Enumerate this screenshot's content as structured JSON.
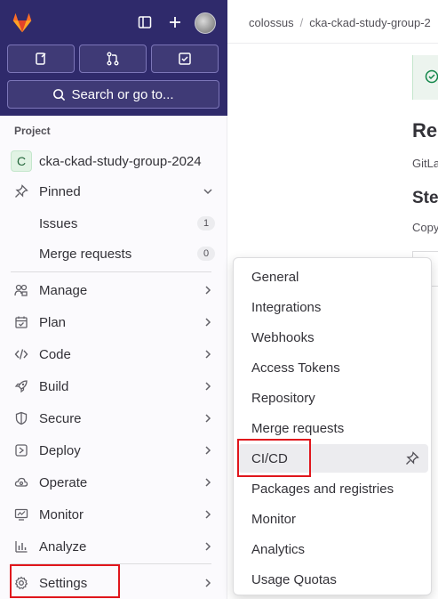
{
  "sidebar": {
    "search_label": "Search or go to...",
    "section_label": "Project",
    "project": {
      "initial": "C",
      "name": "cka-ckad-study-group-2024"
    },
    "pinned": {
      "label": "Pinned",
      "items": [
        {
          "label": "Issues",
          "count": "1"
        },
        {
          "label": "Merge requests",
          "count": "0"
        }
      ]
    },
    "nav": [
      {
        "label": "Manage",
        "icon": "manage-icon"
      },
      {
        "label": "Plan",
        "icon": "plan-icon"
      },
      {
        "label": "Code",
        "icon": "code-icon"
      },
      {
        "label": "Build",
        "icon": "rocket-icon"
      },
      {
        "label": "Secure",
        "icon": "shield-icon"
      },
      {
        "label": "Deploy",
        "icon": "deploy-icon"
      },
      {
        "label": "Operate",
        "icon": "cloud-icon"
      },
      {
        "label": "Monitor",
        "icon": "monitor-icon"
      },
      {
        "label": "Analyze",
        "icon": "chart-icon"
      },
      {
        "label": "Settings",
        "icon": "settings-icon"
      }
    ]
  },
  "breadcrumb": [
    "colossus",
    "cka-ckad-study-group-2"
  ],
  "main": {
    "heading1": "Reg",
    "text1": "GitLa",
    "heading2": "Ste",
    "text2": "Copy"
  },
  "settings_menu": {
    "items": [
      "General",
      "Integrations",
      "Webhooks",
      "Access Tokens",
      "Repository",
      "Merge requests",
      "CI/CD",
      "Packages and registries",
      "Monitor",
      "Analytics",
      "Usage Quotas"
    ],
    "active": "CI/CD"
  },
  "colors": {
    "sidebar_top": "#2f2a6b",
    "highlight": "#e0161c",
    "success": "#108548"
  }
}
